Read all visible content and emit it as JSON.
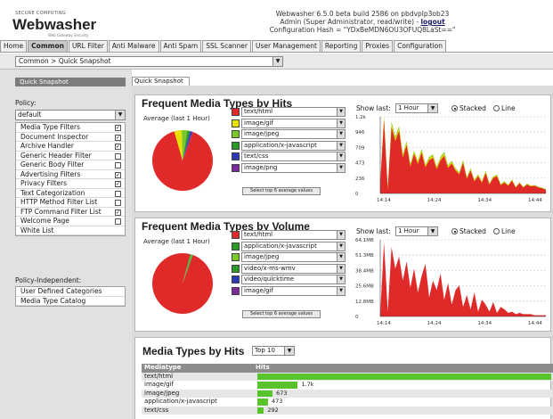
{
  "header": {
    "corp": "SECURE COMPUTING",
    "logo": "Webwasher",
    "logo_sub": "Web Gateway Security",
    "build_line": "Webwasher 6.5.0 beta build 2586 on pbdvplp3ob23",
    "admin_prefix": "Admin (Super Administrator, read/write) - ",
    "logout": "logout",
    "config_hash": "Configuration Hash = \"YDxBeMDN6OU3OFUQ8LaSt==\""
  },
  "tabs": [
    "Home",
    "Common",
    "URL Filter",
    "Anti Malware",
    "Anti Spam",
    "SSL Scanner",
    "User Management",
    "Reporting",
    "Proxies",
    "Configuration"
  ],
  "breadcrumb": {
    "value": "Common > Quick Snapshot",
    "arrow": "▼"
  },
  "left": {
    "quick_snapshot": "Quick Snapshot",
    "policy_label": "Policy:",
    "policy_value": "default",
    "items": [
      {
        "label": "Media Type Filters",
        "checked": true
      },
      {
        "label": "Document Inspector",
        "checked": true
      },
      {
        "label": "Archive Handler",
        "checked": true
      },
      {
        "label": "Generic Header Filter",
        "checked": false
      },
      {
        "label": "Generic Body Filter",
        "checked": false
      },
      {
        "label": "Advertising Filters",
        "checked": true
      },
      {
        "label": "Privacy Filters",
        "checked": true
      },
      {
        "label": "Text Categorization",
        "checked": false
      },
      {
        "label": "HTTP Method Filter List",
        "checked": false
      },
      {
        "label": "FTP Command Filter List",
        "checked": true
      },
      {
        "label": "Welcome Page",
        "checked": false
      },
      {
        "label": "White List",
        "checked": null
      }
    ],
    "policy_independent_label": "Policy-Independent:",
    "independent_items": [
      "User Defined Categories",
      "Media Type Catalog"
    ]
  },
  "right_tab": "Quick Snapshot",
  "panel_hits": {
    "title": "Frequent Media Types by Hits",
    "average": "Average (last 1 Hour)",
    "legend": [
      {
        "label": "text/html",
        "color": "#e02a2a"
      },
      {
        "label": "image/gif",
        "color": "#e8e000"
      },
      {
        "label": "image/jpeg",
        "color": "#7ac82a"
      },
      {
        "label": "application/x-javascript",
        "color": "#2a9a2a"
      },
      {
        "label": "text/css",
        "color": "#2a3ab4"
      },
      {
        "label": "image/png",
        "color": "#7a2a9a"
      }
    ],
    "button": "Select top 6 average values",
    "show_last": "Show last:",
    "period": "1 Hour",
    "stacked": "Stacked",
    "line": "Line",
    "y_ticks": [
      "1.2k",
      "946",
      "709",
      "473",
      "236",
      "0"
    ],
    "x_ticks": [
      "14:14",
      "14:24",
      "14:34",
      "14:44"
    ],
    "pie": [
      0.9,
      0.04,
      0.03,
      0.015,
      0.01,
      0.005
    ],
    "series": {
      "html": [
        150,
        1150,
        60,
        1040,
        820,
        980,
        560,
        760,
        420,
        620,
        460,
        640,
        410,
        520,
        560,
        380,
        520,
        590,
        400,
        470,
        360,
        300,
        480,
        230,
        360,
        190,
        270,
        170,
        320,
        140,
        240,
        270,
        130,
        170,
        120,
        200,
        90,
        160,
        90,
        140,
        110,
        120,
        95,
        80,
        60
      ],
      "gif": [
        0,
        60,
        10,
        50,
        40,
        45,
        30,
        35,
        25,
        30,
        30,
        35,
        25,
        30,
        30,
        25,
        30,
        35,
        25,
        25,
        20,
        18,
        25,
        15,
        20,
        15,
        18,
        12,
        20,
        10,
        15,
        15,
        10,
        12,
        10,
        12,
        8,
        10,
        8,
        8,
        8,
        8,
        6,
        6,
        5
      ],
      "jpeg": [
        0,
        40,
        5,
        35,
        30,
        30,
        20,
        25,
        20,
        20,
        20,
        25,
        15,
        20,
        20,
        15,
        20,
        25,
        15,
        18,
        15,
        12,
        18,
        10,
        15,
        10,
        12,
        8,
        12,
        8,
        10,
        10,
        8,
        8,
        6,
        8,
        6,
        6,
        5,
        5,
        5,
        5,
        4,
        4,
        3
      ]
    }
  },
  "panel_volume": {
    "title": "Frequent Media Types by Volume",
    "average": "Average (last 1 Hour)",
    "legend": [
      {
        "label": "text/html",
        "color": "#e02a2a"
      },
      {
        "label": "application/x-javascript",
        "color": "#2a9a2a"
      },
      {
        "label": "image/jpeg",
        "color": "#7ac82a"
      },
      {
        "label": "video/x-ms-wmv",
        "color": "#2a9a2a"
      },
      {
        "label": "video/quicktime",
        "color": "#2a3ab4"
      },
      {
        "label": "image/gif",
        "color": "#7a2a9a"
      }
    ],
    "button": "Select top 6 average values",
    "show_last": "Show last:",
    "period": "1 Hour",
    "stacked": "Stacked",
    "line": "Line",
    "y_ticks": [
      "64.1MB",
      "51.3MB",
      "38.4MB",
      "25.6MB",
      "12.8MB",
      "0"
    ],
    "x_ticks": [
      "14:14",
      "14:24",
      "14:34",
      "14:44"
    ],
    "pie": [
      0.985,
      0.006,
      0.005,
      0.004
    ],
    "series": {
      "html": [
        2,
        62,
        4,
        58,
        40,
        50,
        30,
        46,
        24,
        40,
        20,
        34,
        44,
        16,
        30,
        22,
        36,
        14,
        28,
        10,
        22,
        26,
        8,
        18,
        6,
        20,
        4,
        14,
        10,
        4,
        12,
        3,
        8,
        6,
        3,
        4,
        2,
        3,
        2,
        2,
        2,
        1,
        1,
        1,
        1
      ]
    }
  },
  "hits_table": {
    "title": "Media Types by Hits",
    "top": "Top 10",
    "col_type": "Mediatype",
    "col_hits": "Hits",
    "rows": [
      {
        "type": "text/html",
        "hits": 13000,
        "label": ""
      },
      {
        "type": "image/gif",
        "hits": 1790,
        "label": "1.7k"
      },
      {
        "type": "image/jpeg",
        "hits": 673,
        "label": "673"
      },
      {
        "type": "application/x-javascript",
        "hits": 473,
        "label": "473"
      },
      {
        "type": "text/css",
        "hits": 292,
        "label": "292"
      }
    ]
  }
}
